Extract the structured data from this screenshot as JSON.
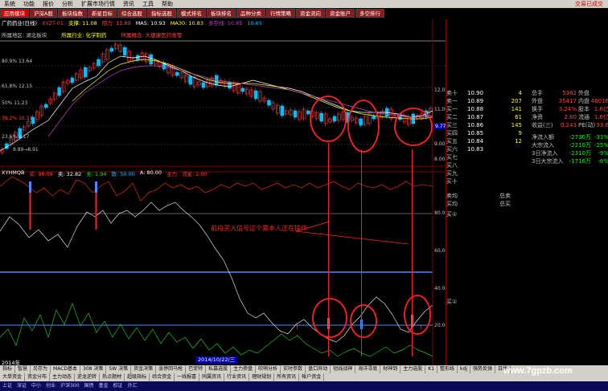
{
  "menubar": {
    "items": [
      "系统",
      "功能",
      "报价",
      "分析",
      "扩展市场行情",
      "资讯",
      "工具",
      "帮助"
    ],
    "brand": "交易已成交"
  },
  "tabs": [
    "应用模块",
    "沪深A股",
    "板块指数",
    "新星目标",
    "综合选股",
    "指标选股",
    "模式排名",
    "板块排名",
    "品种分类",
    "行情策略",
    "资金流向",
    "资金账户",
    "多空排行"
  ],
  "stock_header": {
    "name": "广药药业(日线)",
    "code": "XYZT-01",
    "field1": "支撑: 11.08",
    "field2": "阻力: 11.89",
    "ma5": "MA5: 10.93",
    "ma30": "MA30: 10.83",
    "ma_b": "多空线: 10.85",
    "ma_c": "10.65"
  },
  "sector_bar": {
    "a": "所属地区: 湖北板块",
    "b": "所属行业: 化学制药",
    "c": "所属概念: 大健康医药食零"
  },
  "left_pct": [
    {
      "label": "80.9% 13.64",
      "color": "#c0c0c0"
    },
    {
      "label": "61.8% 12.15",
      "color": "#c0c0c0"
    },
    {
      "label": "50% 11.23",
      "color": "#c0c0c0"
    },
    {
      "label": "38.2% 10.31",
      "color": "#ff4040"
    },
    {
      "label": "23.6% 9.17",
      "color": "#c0c0c0"
    },
    {
      "label": "8.89→8.91",
      "color": "#c0c0c0"
    }
  ],
  "right_price_axis": [
    "12.00",
    "11.00",
    "10.00",
    "9.00",
    "8.00"
  ],
  "current_price_tag": "9.77",
  "indicator_header": {
    "name": "XYHMQB",
    "a": "买: 98.08",
    "b": "卖: 32.82",
    "c": "无: 1.94",
    "d": "散: 50.00",
    "e": "A: 80.00",
    "f": "主力",
    "g": "流星: 2.00"
  },
  "ind_axis": [
    "80.00",
    "60.00",
    "40.00",
    "20.00"
  ],
  "annotation": "前段买入信号这个票本人正在操作",
  "date_box": "2014/10/22/三",
  "date_left": "2014年",
  "quote_asks": [
    {
      "label": "卖十",
      "price": "10.90",
      "vol": "4"
    },
    {
      "label": "卖一",
      "price": "10.89",
      "vol": "207"
    },
    {
      "label": "买一",
      "price": "10.88",
      "vol": "141"
    },
    {
      "label": "买二",
      "price": "10.87",
      "vol": "61"
    },
    {
      "label": "买三",
      "price": "10.86",
      "vol": "145"
    },
    {
      "label": "买四",
      "price": "10.85",
      "vol": "9"
    },
    {
      "label": "买五",
      "price": "10.84",
      "vol": "12"
    },
    {
      "label": "买六",
      "price": "10.83",
      "vol": ""
    },
    {
      "label": "买七",
      "price": "",
      "vol": ""
    },
    {
      "label": "买八",
      "price": "",
      "vol": ""
    },
    {
      "label": "买九",
      "price": "",
      "vol": ""
    },
    {
      "label": "买十",
      "price": "",
      "vol": ""
    }
  ],
  "quote_bottom": [
    {
      "label": "卖均",
      "right": "总卖"
    },
    {
      "label": "买均",
      "right": "总买"
    }
  ],
  "info_rows": [
    {
      "k": "总手",
      "v": "5382",
      "k2": "外盘",
      "v2": ""
    },
    {
      "k": "外盘",
      "v": "35417",
      "k2": "内盘",
      "v2": "46016"
    },
    {
      "k": "换手",
      "v": "3.24%",
      "k2": "股本",
      "v2": "1.6亿"
    },
    {
      "k": "净资",
      "v": "2.60",
      "k2": "流通",
      "v2": "1.6亿"
    },
    {
      "k": "收益(三)",
      "v": "0.243",
      "k2": "PE(动)",
      "v2": "33.6"
    }
  ],
  "stat_rows": [
    {
      "k": "净流入额",
      "v": "-2730万",
      "p": "-31%"
    },
    {
      "k": "大宗流入",
      "v": "-2210万",
      "p": "-25%"
    },
    {
      "k": "3日净流入",
      "v": "-2310万",
      "p": "-9%"
    },
    {
      "k": "3日大宗流入",
      "v": "-1716万",
      "p": "-6%"
    }
  ],
  "quote_side_labels": [
    "买①",
    "买①"
  ],
  "bottom_tabs_1": [
    "指标",
    "智慧",
    "另存为",
    "MACD基本",
    "308 决策",
    "SW 决策",
    "资金决策",
    "涨停回马枪",
    "巴菲特",
    "私募选股",
    "主力掺盘",
    "吹哨分析",
    "实时参数",
    "盘口异动",
    "短线战神",
    "海洋寻底",
    "财神到",
    "主力选股",
    "K1",
    "整形线",
    "kdj",
    "强势反弹",
    "日线"
  ],
  "bottom_tabs_2": [
    "大单资金",
    "资金分布",
    "主力动态",
    "逆龙逆转",
    "热点题材",
    "超级指标",
    "综合资金",
    "一线报喜",
    "同属资讯",
    "行业资讯",
    "理财规划",
    "所有资讯",
    "帐户资金"
  ],
  "status_tabs": [
    "上证",
    "深证",
    "中小",
    "创业",
    "沪深300",
    "国债",
    "基金",
    "权证",
    "外汇"
  ],
  "watermark": "www.7gpzb.com",
  "colors": {
    "up": "#ff4040",
    "down": "#00c0ff",
    "ma5": "#ffffff",
    "ma30": "#ffff00",
    "highlight_circle": "#ff2020"
  }
}
